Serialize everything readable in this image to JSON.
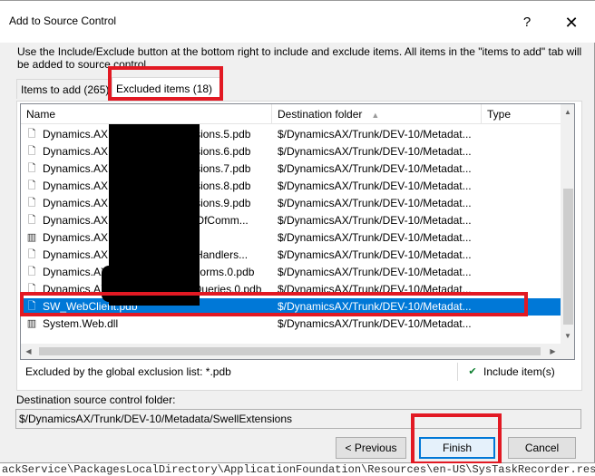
{
  "window": {
    "title": "Add to Source Control",
    "help_glyph": "?",
    "close_glyph": "✕"
  },
  "description": "Use the Include/Exclude button at the bottom right to include and exclude items. All items in the \"items to add\" tab will be added to source control.",
  "tabs": [
    {
      "label": "Items to add (265)",
      "selected": false
    },
    {
      "label": "Excluded items (18)",
      "selected": true
    }
  ],
  "list": {
    "columns": {
      "name": "Name",
      "destination": "Destination folder",
      "type": "Type",
      "sort_indicator": "▲"
    },
    "rows": [
      {
        "icon": "document-lock-icon",
        "icon_glyph": "🗋",
        "name": "Dynamics.AX.Application.Extensions.5.pdb",
        "destination": "$/DynamicsAX/Trunk/DEV-10/Metadat...",
        "type": "",
        "selected": false
      },
      {
        "icon": "document-lock-icon",
        "icon_glyph": "🗋",
        "name": "Dynamics.AX.Application.Extensions.6.pdb",
        "destination": "$/DynamicsAX/Trunk/DEV-10/Metadat...",
        "type": "",
        "selected": false
      },
      {
        "icon": "document-lock-icon",
        "icon_glyph": "🗋",
        "name": "Dynamics.AX.Application.Extensions.7.pdb",
        "destination": "$/DynamicsAX/Trunk/DEV-10/Metadat...",
        "type": "",
        "selected": false
      },
      {
        "icon": "document-lock-icon",
        "icon_glyph": "🗋",
        "name": "Dynamics.AX.Application.Extensions.8.pdb",
        "destination": "$/DynamicsAX/Trunk/DEV-10/Metadat...",
        "type": "",
        "selected": false
      },
      {
        "icon": "document-lock-icon",
        "icon_glyph": "🗋",
        "name": "Dynamics.AX.Application.Extensions.9.pdb",
        "destination": "$/DynamicsAX/Trunk/DEV-10/Metadat...",
        "type": "",
        "selected": false
      },
      {
        "icon": "document-lock-icon",
        "icon_glyph": "🗋",
        "name": "Dynamics.AX.Application.ChainOfComm...",
        "destination": "$/DynamicsAX/Trunk/DEV-10/Metadat...",
        "type": "",
        "selected": false
      },
      {
        "icon": "assembly-icon",
        "icon_glyph": "▥",
        "name": "Dynamics.AX.Application.dll",
        "destination": "$/DynamicsAX/Trunk/DEV-10/Metadat...",
        "type": "",
        "selected": false
      },
      {
        "icon": "document-lock-icon",
        "icon_glyph": "🗋",
        "name": "Dynamics.AX.Application.EventHandlers...",
        "destination": "$/DynamicsAX/Trunk/DEV-10/Metadat...",
        "type": "",
        "selected": false
      },
      {
        "icon": "document-lock-icon",
        "icon_glyph": "🗋",
        "name": "Dynamics.AX.SwellExtensions.Forms.0.pdb",
        "destination": "$/DynamicsAX/Trunk/DEV-10/Metadat...",
        "type": "",
        "selected": false
      },
      {
        "icon": "document-lock-icon",
        "icon_glyph": "🗋",
        "name": "Dynamics.AX.SwellExtensions.Queries.0.pdb",
        "destination": "$/DynamicsAX/Trunk/DEV-10/Metadat...",
        "type": "",
        "selected": false
      },
      {
        "icon": "document-lock-icon",
        "icon_glyph": "🗋",
        "name": "SW_WebClient.pdb",
        "destination": "$/DynamicsAX/Trunk/DEV-10/Metadat...",
        "type": "",
        "selected": true
      },
      {
        "icon": "assembly-icon",
        "icon_glyph": "▥",
        "name": "System.Web.dll",
        "destination": "$/DynamicsAX/Trunk/DEV-10/Metadat...",
        "type": "",
        "selected": false
      }
    ],
    "scroll_up_glyph": "▲",
    "scroll_down_glyph": "▼",
    "scroll_left_glyph": "◀",
    "scroll_right_glyph": "▶"
  },
  "status": {
    "exclusion_text": "Excluded by the global exclusion list: *.pdb",
    "include_label": "Include item(s)",
    "include_glyph": "✔"
  },
  "destination": {
    "label": "Destination source control folder:",
    "value": "$/DynamicsAX/Trunk/DEV-10/Metadata/SwellExtensions"
  },
  "buttons": {
    "previous": "< Previous",
    "finish": "Finish",
    "cancel": "Cancel"
  },
  "background_text": "ackService\\PackagesLocalDirectory\\ApplicationFoundation\\Resources\\en-US\\SysTaskRecorder.resx",
  "colors": {
    "selection": "#0078d7",
    "annotation_red": "#e21923",
    "dialog_bg": "#f0f0f0"
  }
}
